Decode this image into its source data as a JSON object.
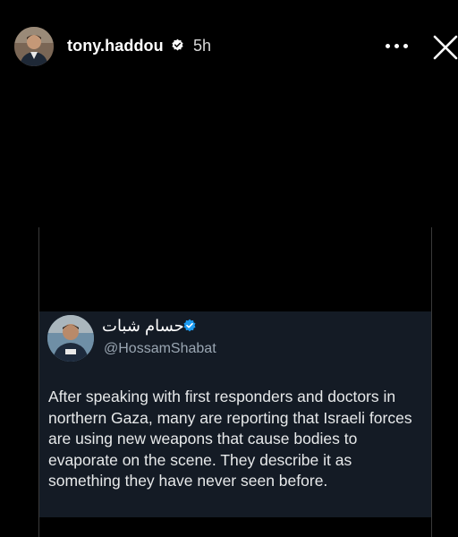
{
  "story": {
    "username": "tony.haddou",
    "time_ago": "5h",
    "verified_icon": "verified-badge-icon",
    "more_icon": "more-horizontal-icon",
    "close_icon": "close-icon"
  },
  "tweet": {
    "display_name": "حسام شبات",
    "handle": "@HossamShabat",
    "verified_icon": "verified-badge-icon",
    "text": "After speaking with first responders and doctors in northern Gaza, many are reporting that Israeli forces are using new weapons that cause bodies to evaporate on the scene. They describe it as something they have never seen before.",
    "accent_color": "#1d9bf0",
    "background_color": "#141b25"
  }
}
